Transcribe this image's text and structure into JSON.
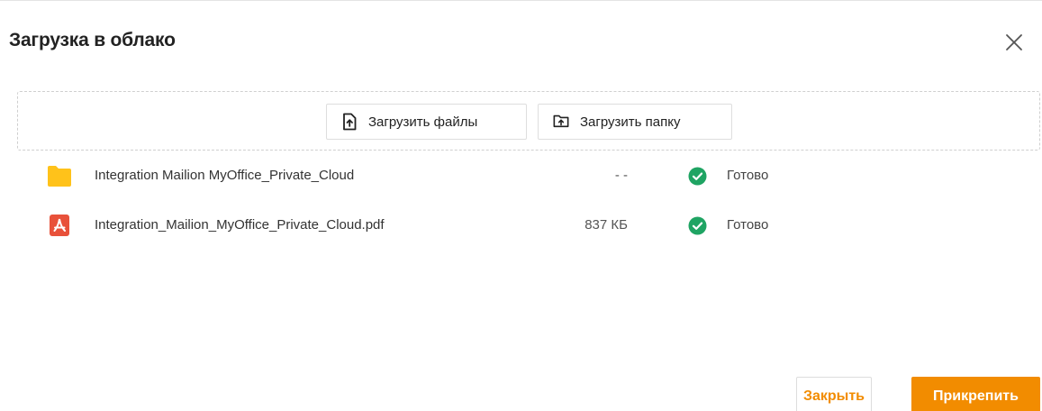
{
  "dialog": {
    "title": "Загрузка в облако"
  },
  "dropzone": {
    "upload_files_label": "Загрузить файлы",
    "upload_folder_label": "Загрузить папку"
  },
  "files": [
    {
      "name": "Integration Mailion MyOffice_Private_Cloud",
      "type": "folder",
      "size": "- -",
      "status": "Готово"
    },
    {
      "name": "Integration_Mailion_MyOffice_Private_Cloud.pdf",
      "type": "pdf",
      "size": "837 КБ",
      "status": "Готово"
    }
  ],
  "footer": {
    "close_label": "Закрыть",
    "attach_label": "Прикрепить"
  },
  "icons": {
    "close": "close-icon",
    "upload_file": "file-upload-icon",
    "upload_folder": "folder-upload-icon",
    "folder": "folder-icon",
    "pdf": "pdf-icon",
    "status_done": "check-circle-icon"
  },
  "colors": {
    "accent": "#f28c00",
    "success": "#1fa463",
    "folder": "#ffc21a",
    "pdf": "#e8513a"
  }
}
